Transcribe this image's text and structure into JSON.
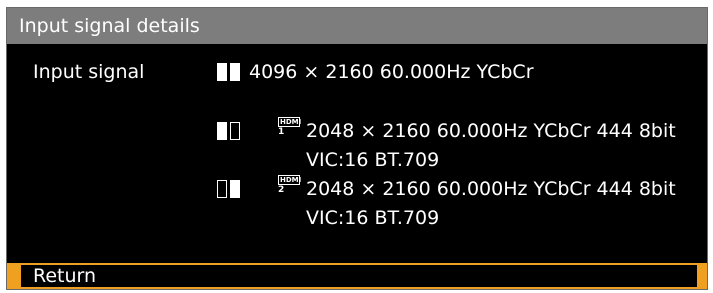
{
  "window": {
    "title": "Input signal details"
  },
  "signal": {
    "label": "Input signal",
    "main_value": "4096 × 2160 60.000Hz YCbCr"
  },
  "inputs": [
    {
      "port_logo": "HDMI",
      "port_number": "1",
      "line1": "2048 × 2160 60.000Hz YCbCr 444 8bit",
      "line2": "VIC:16 BT.709",
      "indicator": "left-filled"
    },
    {
      "port_logo": "HDMI",
      "port_number": "2",
      "line1": "2048 × 2160 60.000Hz YCbCr 444 8bit",
      "line2": "VIC:16 BT.709",
      "indicator": "right-filled"
    }
  ],
  "footer": {
    "return_label": "Return"
  },
  "colors": {
    "titlebar": "#7d7d7d",
    "background": "#000000",
    "highlight": "#f0a020",
    "text": "#ffffff"
  },
  "icons": {
    "split_screen": "split-screen-icon",
    "hdmi": "hdmi-port-icon"
  }
}
